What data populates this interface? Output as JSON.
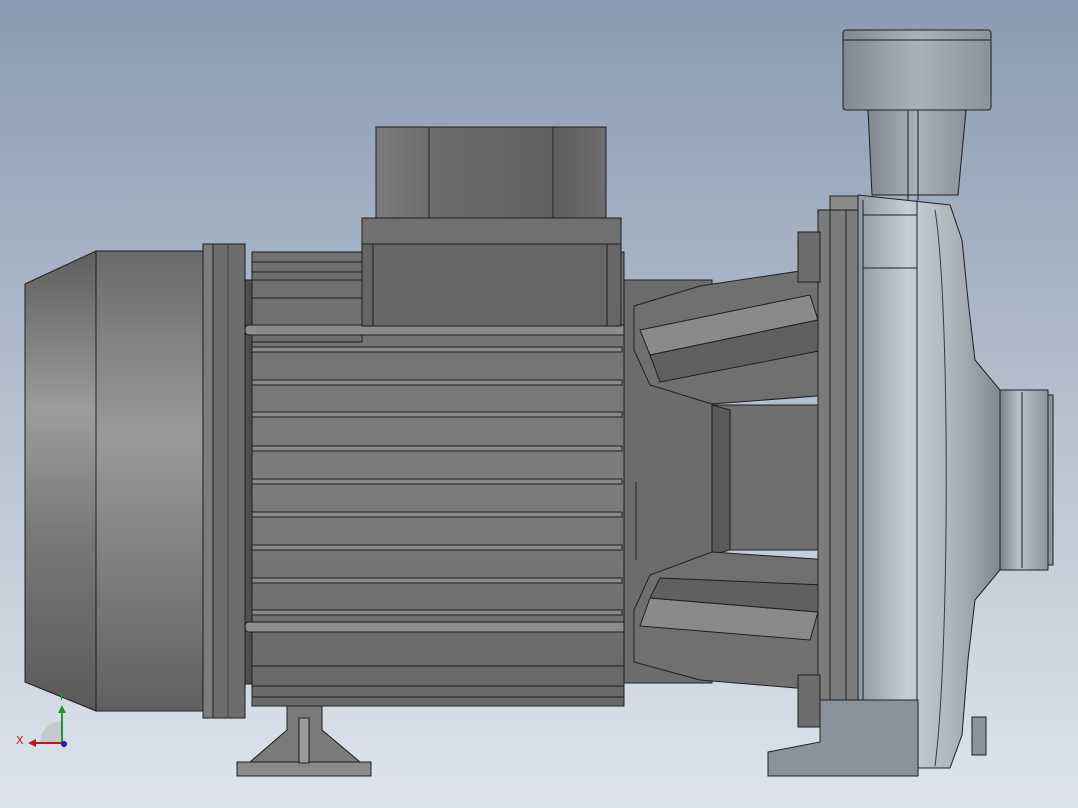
{
  "viewport": {
    "background_top": "#8a9bb1",
    "background_bottom": "#dfe4ec"
  },
  "model": {
    "name": "centrifugal-pump",
    "view": "right side view",
    "colors": {
      "body_dark": "#5b5b5b",
      "body_mid": "#767676",
      "body_light": "#9a9a9a",
      "fin": "#6e6e6e",
      "edge": "#1f1f1f",
      "volute_light": "#c9d0d8",
      "volute_mid": "#9ba4ad"
    }
  },
  "triad": {
    "x_label": "X",
    "y_label": "Y",
    "x_color": "#c01818",
    "y_color": "#1a9a2a",
    "z_color": "#2020b0"
  }
}
